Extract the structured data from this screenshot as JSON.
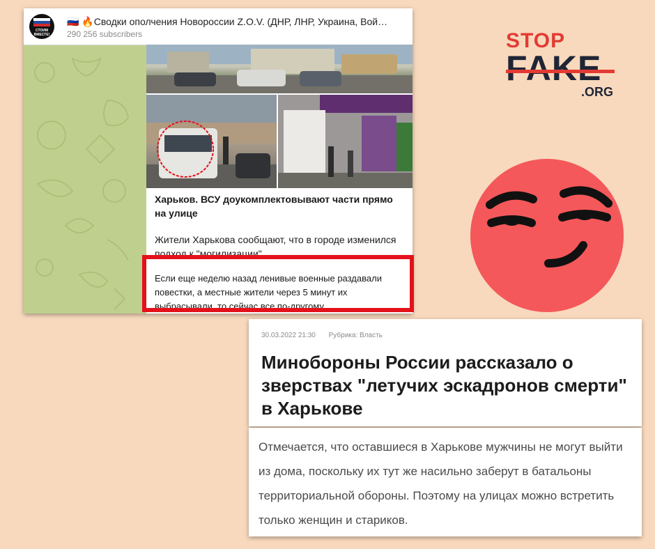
{
  "telegram": {
    "channel_title": "🇷🇺 🔥Сводки ополчения Новороссии Z.O.V. (ДНР, ЛНР, Украина, Вой…",
    "subscribers": "290 256 subscribers",
    "avatar_text": "СТОИМ ВМЕСТЕ!",
    "post_heading": "Харьков. ВСУ доукомплектовывают части прямо на улице",
    "post_text_1": "Жители Харькова сообщают, что в городе изменился подход к \"могилизации\".",
    "post_text_2": "Если еще неделю назад ленивые военные раздавали повестки, а местные жители через 5 минут их выбрасывали, то сейчас все по-другому…"
  },
  "logo": {
    "stop": "STOP",
    "fake": "FAKE",
    "org": ".ORG",
    "colors": {
      "red": "#e33b33",
      "dark": "#1f2535"
    }
  },
  "emoji": {
    "icon": "smirking-face-icon",
    "color": "#f5585a"
  },
  "article": {
    "date": "30.03.2022 21:30",
    "rubric": "Рубрика: Власть",
    "title": "Минобороны России рассказало о зверствах \"летучих эскадронов смерти\" в Харькове",
    "quote": "Отмечается, что оставшиеся в Харькове мужчины не могут выйти из дома, поскольку их тут же насильно заберут в батальоны территориальной обороны. Поэтому на улицах можно встретить только женщин и стариков."
  },
  "colors": {
    "background": "#f8d9bd",
    "highlight": "#e4111b",
    "telegram_bg": "#bfd08e"
  }
}
